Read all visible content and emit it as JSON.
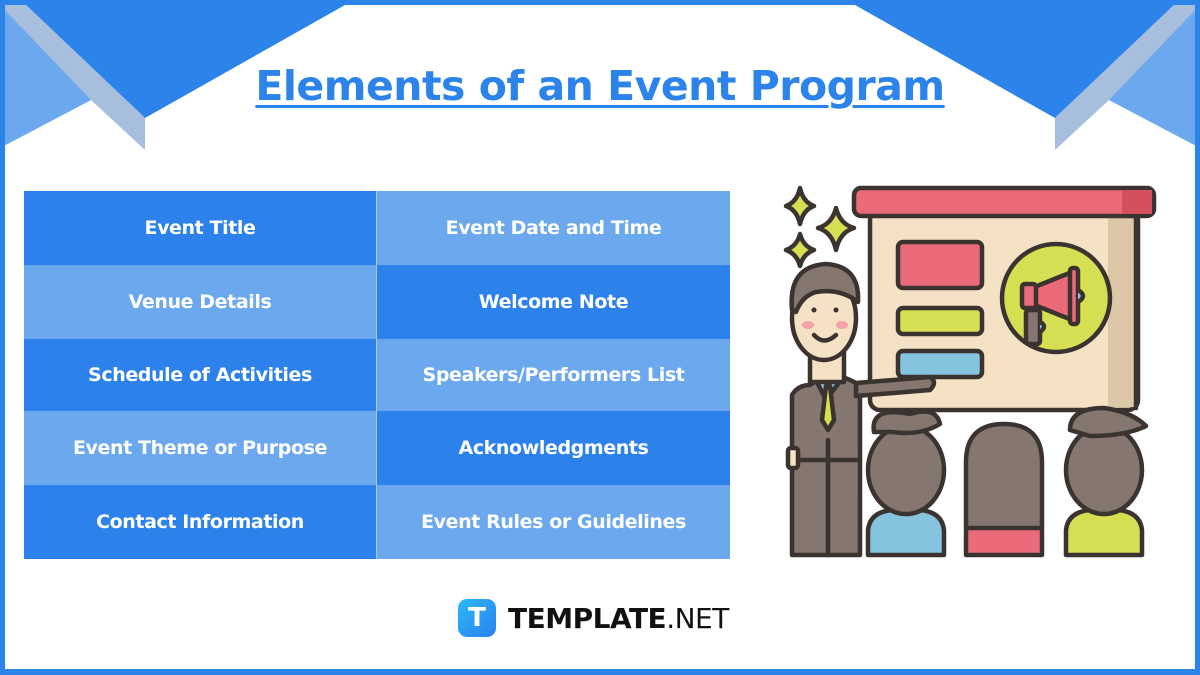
{
  "title": "Elements of an Event Program",
  "elements": [
    {
      "label": "Event Title",
      "shade": "dark"
    },
    {
      "label": "Event Date and Time",
      "shade": "light"
    },
    {
      "label": "Venue Details",
      "shade": "light"
    },
    {
      "label": "Welcome Note",
      "shade": "dark"
    },
    {
      "label": "Schedule of Activities",
      "shade": "dark"
    },
    {
      "label": "Speakers/Performers List",
      "shade": "light"
    },
    {
      "label": "Event Theme or Purpose",
      "shade": "light"
    },
    {
      "label": "Acknowledgments",
      "shade": "dark"
    },
    {
      "label": "Contact Information",
      "shade": "dark"
    },
    {
      "label": "Event Rules or Guidelines",
      "shade": "light"
    }
  ],
  "illustration": {
    "subject": "presenter-at-board-with-audience-icon",
    "board_icon": "megaphone-icon"
  },
  "brand": {
    "logo_letter": "T",
    "name": "TEMPLATE",
    "tld": ".NET"
  },
  "colors": {
    "primary_blue": "#2c84ea",
    "light_blue": "#6ca8ee",
    "pale_blue": "#a8bedd",
    "board_red": "#ea6a7a",
    "lime": "#d6df52",
    "sky": "#86c3df",
    "board_cream": "#f5e1c4",
    "suit_grey": "#857670",
    "outline": "#3a3330"
  }
}
